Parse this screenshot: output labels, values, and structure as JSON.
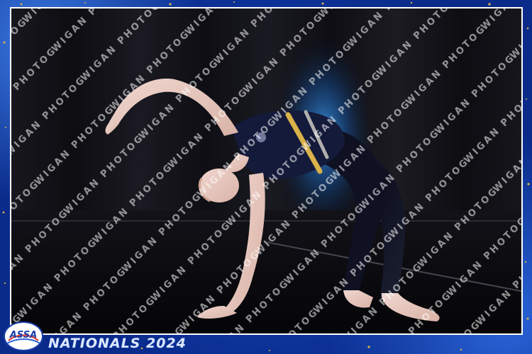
{
  "event": {
    "title": "NATIONALS 2024",
    "logo_text": "ASSA"
  },
  "watermark": {
    "text": "WIGAN PHOTOGRAPHY"
  },
  "colors": {
    "frame_blue": "#1545c0",
    "gold_sparkle": "#d9b24a",
    "leotard_navy": "#141a3a",
    "stage_black": "#0a0a0f"
  }
}
